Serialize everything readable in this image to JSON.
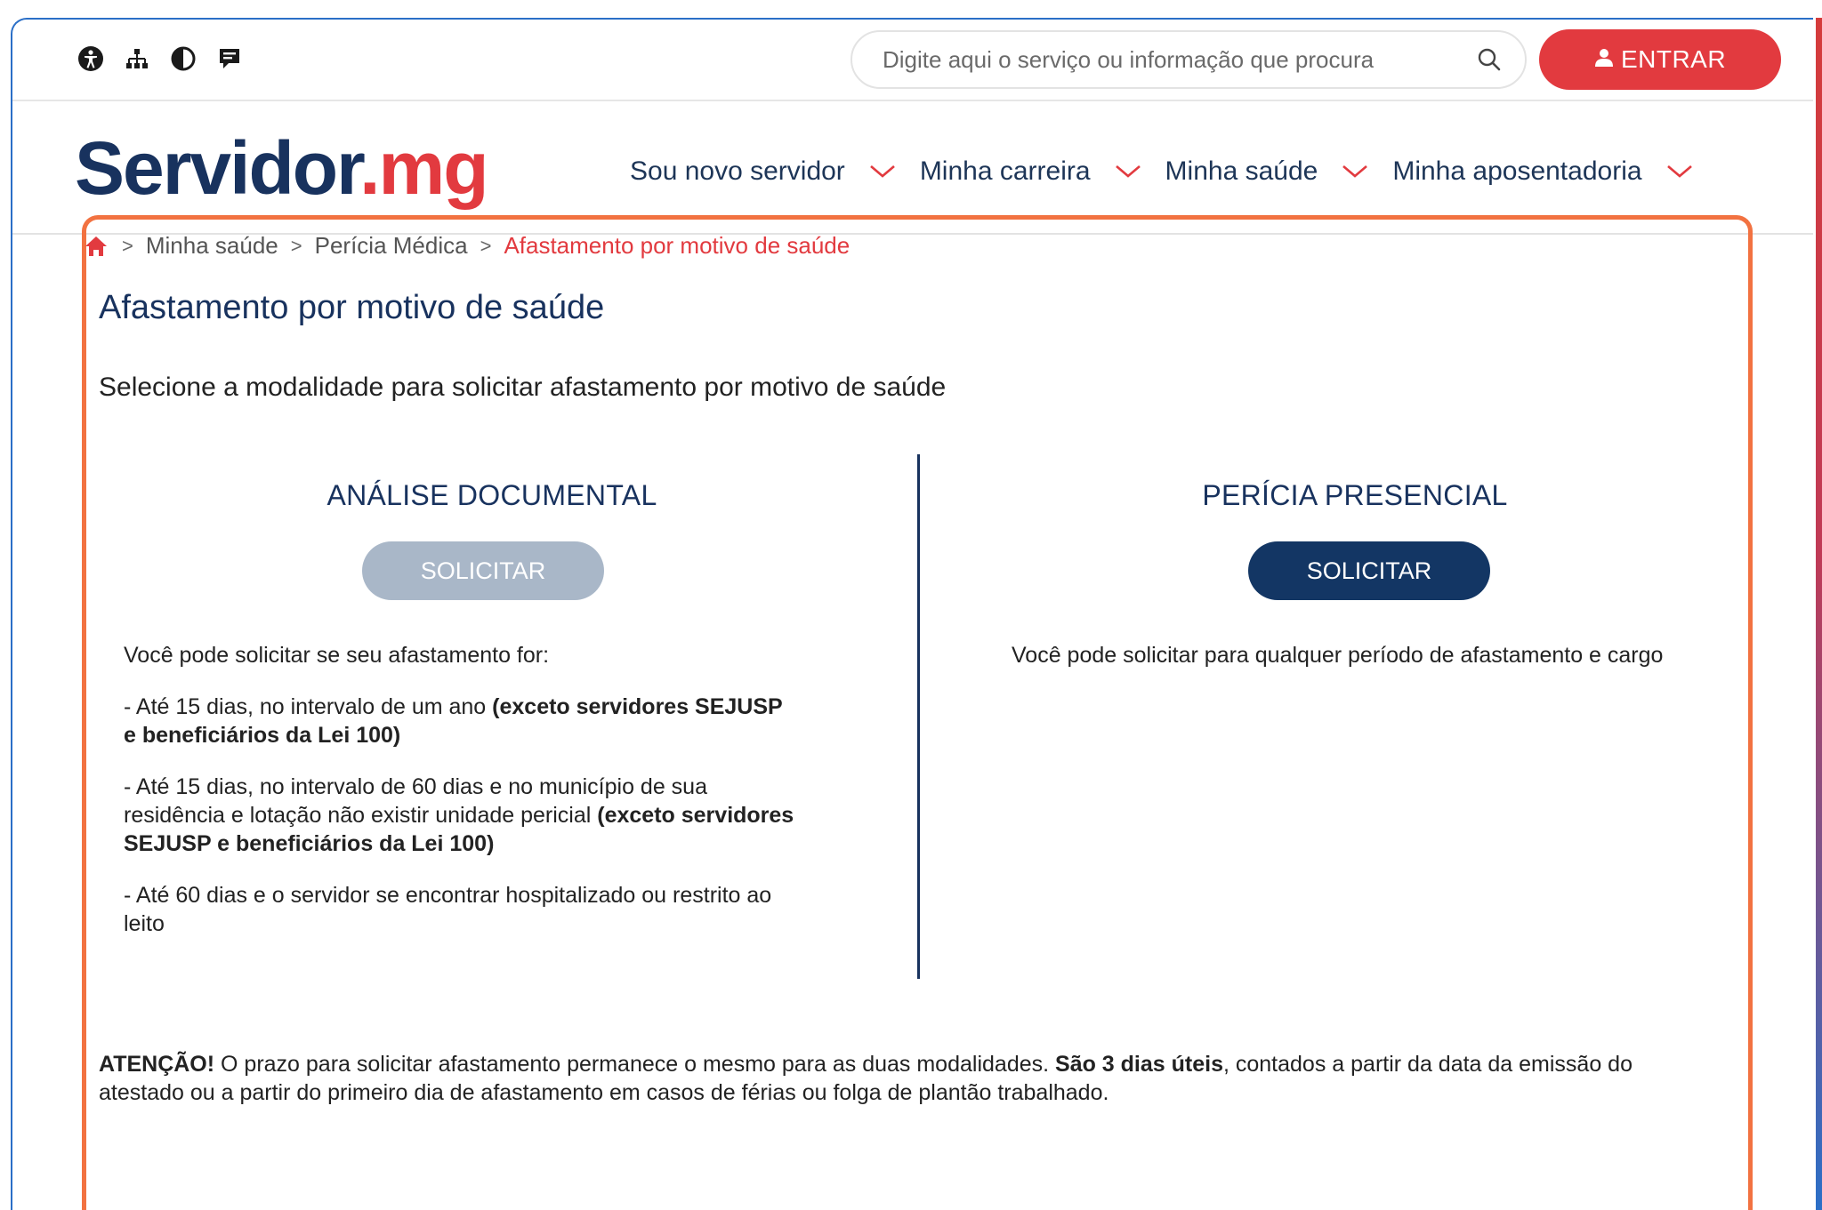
{
  "topbar": {
    "accessibility_icons": [
      "accessibility-icon",
      "sitemap-icon",
      "contrast-icon",
      "feedback-icon"
    ],
    "search_placeholder": "Digite aqui o serviço ou informação que procura",
    "login_label": "ENTRAR"
  },
  "logo": {
    "part1": "Servidor",
    "dot": ".",
    "part2": "mg"
  },
  "nav": {
    "items": [
      {
        "label": "Sou novo servidor"
      },
      {
        "label": "Minha carreira"
      },
      {
        "label": "Minha saúde"
      },
      {
        "label": "Minha aposentadoria"
      }
    ]
  },
  "breadcrumb": {
    "items": [
      "Minha saúde",
      "Perícia Médica"
    ],
    "current": "Afastamento por motivo de saúde",
    "separator": ">"
  },
  "page": {
    "title": "Afastamento por motivo de saúde",
    "subtitle": "Selecione a modalidade para solicitar afastamento por motivo de saúde"
  },
  "options": {
    "documental": {
      "title": "ANÁLISE DOCUMENTAL",
      "button": "SOLICITAR",
      "intro": "Você pode solicitar se seu afastamento for:",
      "rule1_text": "- Até 15 dias, no intervalo de um ano ",
      "rule1_bold": "(exceto servidores SEJUSP e beneficiários da Lei 100)",
      "rule2_text": "- Até 15 dias, no intervalo de 60 dias e no município de sua residência e lotação não existir unidade pericial ",
      "rule2_bold_1": "(exceto servidores",
      "rule2_bold_2": "SEJUSP e beneficiários da Lei 100)",
      "rule3_text": "- Até 60 dias e o servidor se encontrar hospitalizado ou restrito ao leito"
    },
    "presencial": {
      "title": "PERÍCIA PRESENCIAL",
      "button": "SOLICITAR",
      "description": "Você pode solicitar para qualquer período de afastamento e cargo"
    }
  },
  "attention": {
    "label": "ATENÇÃO!",
    "text1": " O prazo para solicitar afastamento permanece o mesmo para as duas modalidades. ",
    "bold": "São 3 dias úteis",
    "text2": ", contados a partir da data da emissão do atestado ou a partir do primeiro dia de afastamento em casos de férias ou folga de plantão trabalhado."
  },
  "colors": {
    "brand_navy": "#18325e",
    "brand_red": "#e23a3f",
    "highlight_orange": "#f27241",
    "disabled_button": "#a9b7c8",
    "primary_button": "#133664"
  }
}
